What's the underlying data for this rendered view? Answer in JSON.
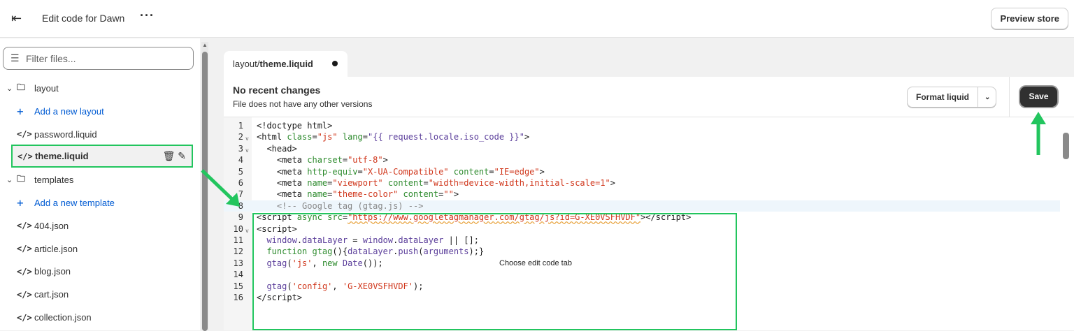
{
  "header": {
    "title": "Edit code for Dawn",
    "more_icon": "ellipsis-icon",
    "back_icon": "exit-icon",
    "preview_label": "Preview store"
  },
  "sidebar": {
    "filter_placeholder": "Filter files...",
    "items": [
      {
        "type": "folder",
        "label": "layout"
      },
      {
        "type": "add",
        "label": "Add a new layout"
      },
      {
        "type": "file",
        "label": "password.liquid"
      },
      {
        "type": "file",
        "label": "theme.liquid",
        "selected": true
      },
      {
        "type": "folder",
        "label": "templates"
      },
      {
        "type": "add",
        "label": "Add a new template"
      },
      {
        "type": "file",
        "label": "404.json"
      },
      {
        "type": "file",
        "label": "article.json"
      },
      {
        "type": "file",
        "label": "blog.json"
      },
      {
        "type": "file",
        "label": "cart.json"
      },
      {
        "type": "file",
        "label": "collection.json"
      }
    ]
  },
  "editor": {
    "tab": {
      "folder": "layout/",
      "file": "theme.liquid",
      "unsaved": true
    },
    "status_title": "No recent changes",
    "status_sub": "File does not have any other versions",
    "format_label": "Format liquid",
    "save_label": "Save",
    "annotation": "Choose edit code tab",
    "accent": "#22c55e",
    "lines": [
      [
        [
          "<!doctype html>",
          "t"
        ]
      ],
      [
        [
          "<html ",
          "t"
        ],
        [
          "class",
          "a"
        ],
        [
          "=",
          "t"
        ],
        [
          "\"js\"",
          "s"
        ],
        [
          " ",
          "t"
        ],
        [
          "lang",
          "a"
        ],
        [
          "=",
          "t"
        ],
        [
          "\"{{ request.locale.iso_code }}\"",
          "v"
        ],
        [
          ">",
          "t"
        ]
      ],
      [
        [
          "  <head>",
          "t"
        ]
      ],
      [
        [
          "    <meta ",
          "t"
        ],
        [
          "charset",
          "a"
        ],
        [
          "=",
          "t"
        ],
        [
          "\"utf-8\"",
          "s"
        ],
        [
          ">",
          "t"
        ]
      ],
      [
        [
          "    <meta ",
          "t"
        ],
        [
          "http-equiv",
          "a"
        ],
        [
          "=",
          "t"
        ],
        [
          "\"X-UA-Compatible\"",
          "s"
        ],
        [
          " ",
          "t"
        ],
        [
          "content",
          "a"
        ],
        [
          "=",
          "t"
        ],
        [
          "\"IE=edge\"",
          "s"
        ],
        [
          ">",
          "t"
        ]
      ],
      [
        [
          "    <meta ",
          "t"
        ],
        [
          "name",
          "a"
        ],
        [
          "=",
          "t"
        ],
        [
          "\"viewport\"",
          "s"
        ],
        [
          " ",
          "t"
        ],
        [
          "content",
          "a"
        ],
        [
          "=",
          "t"
        ],
        [
          "\"width=device-width,initial-scale=1\"",
          "s"
        ],
        [
          ">",
          "t"
        ]
      ],
      [
        [
          "    <meta ",
          "t"
        ],
        [
          "name",
          "a"
        ],
        [
          "=",
          "t"
        ],
        [
          "\"theme-color\"",
          "s"
        ],
        [
          " ",
          "t"
        ],
        [
          "content",
          "a"
        ],
        [
          "=",
          "t"
        ],
        [
          "\"\"",
          "s"
        ],
        [
          ">",
          "t"
        ]
      ],
      [
        [
          "    <!-- Google tag (gtag.js) -->",
          "c"
        ]
      ],
      [
        [
          "<script ",
          "t"
        ],
        [
          "async ",
          "a"
        ],
        [
          "src",
          "a"
        ],
        [
          "=",
          "t"
        ],
        [
          "\"https://www.googletagmanager.com/gtag/js?id=G-XE0VSFHVDF\"",
          "s squig"
        ],
        [
          "></script>",
          "t"
        ]
      ],
      [
        [
          "<script>",
          "t"
        ]
      ],
      [
        [
          "  ",
          "t"
        ],
        [
          "window",
          "v"
        ],
        [
          ".",
          "t"
        ],
        [
          "dataLayer",
          "v"
        ],
        [
          " = ",
          "t"
        ],
        [
          "window",
          "v"
        ],
        [
          ".",
          "t"
        ],
        [
          "dataLayer",
          "v"
        ],
        [
          " || [];",
          "t"
        ]
      ],
      [
        [
          "  ",
          "t"
        ],
        [
          "function ",
          "k"
        ],
        [
          "gtag",
          "a"
        ],
        [
          "(){",
          "t"
        ],
        [
          "dataLayer",
          "v"
        ],
        [
          ".",
          "t"
        ],
        [
          "push",
          "v"
        ],
        [
          "(",
          "t"
        ],
        [
          "arguments",
          "v"
        ],
        [
          ");}",
          "t"
        ]
      ],
      [
        [
          "  ",
          "t"
        ],
        [
          "gtag",
          "v"
        ],
        [
          "(",
          "t"
        ],
        [
          "'js'",
          "s"
        ],
        [
          ", ",
          "t"
        ],
        [
          "new ",
          "k"
        ],
        [
          "Date",
          "v"
        ],
        [
          "());",
          "t"
        ]
      ],
      [
        [
          "",
          "t"
        ]
      ],
      [
        [
          "  ",
          "t"
        ],
        [
          "gtag",
          "v"
        ],
        [
          "(",
          "t"
        ],
        [
          "'config'",
          "s"
        ],
        [
          ", ",
          "t"
        ],
        [
          "'G-XE0VSFHVDF'",
          "s"
        ],
        [
          ");",
          "t"
        ]
      ],
      [
        [
          "</script>",
          "t"
        ]
      ]
    ],
    "fold_lines": [
      2,
      3,
      10
    ],
    "active_line": 8
  }
}
